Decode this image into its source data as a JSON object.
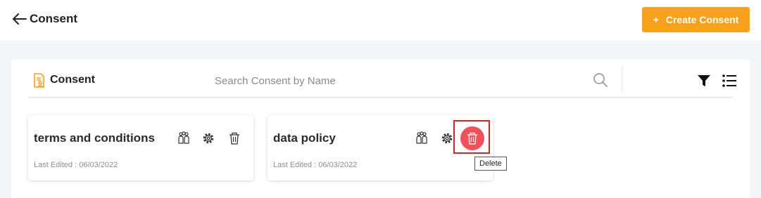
{
  "header": {
    "back_icon": "arrow-left-icon",
    "title": "Consent",
    "create_button": {
      "icon": "+",
      "label": "Create Consent",
      "color": "#f7a11c"
    }
  },
  "panel": {
    "title_icon": "consent-document-icon",
    "title": "Consent",
    "search": {
      "placeholder": "Search Consent by Name",
      "value": ""
    },
    "toolbar_icons": [
      "search-icon",
      "filter-icon",
      "list-view-icon"
    ]
  },
  "cards": [
    {
      "title": "terms and conditions",
      "last_edited": "Last Edited : 06/03/2022",
      "actions": [
        "users-icon",
        "settings-icon",
        "trash-icon"
      ]
    },
    {
      "title": "data policy",
      "last_edited": "Last Edited : 06/03/2022",
      "actions": [
        "users-icon",
        "settings-icon",
        "trash-icon"
      ],
      "delete_active_color": "#f2505a"
    }
  ],
  "tooltip": {
    "text": "Delete"
  }
}
